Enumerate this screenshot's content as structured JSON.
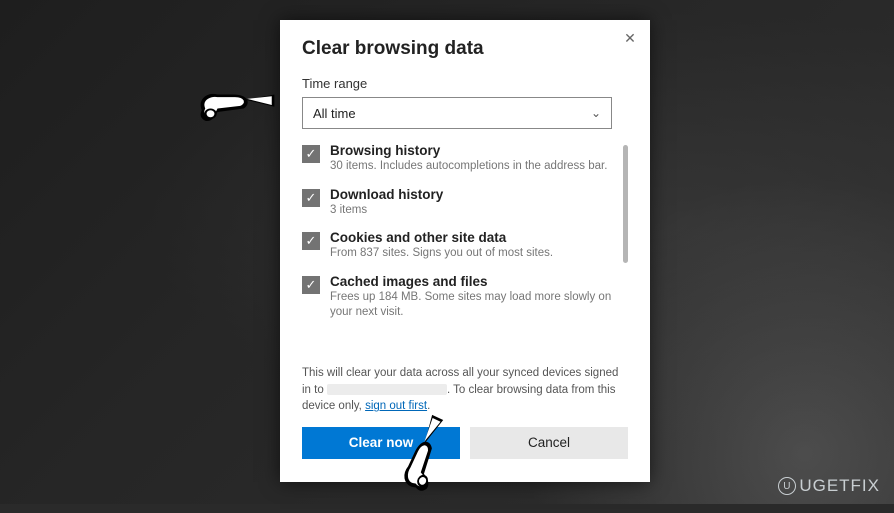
{
  "dialog": {
    "title": "Clear browsing data",
    "time_range_label": "Time range",
    "time_range_value": "All time",
    "options": [
      {
        "title": "Browsing history",
        "desc": "30 items. Includes autocompletions in the address bar."
      },
      {
        "title": "Download history",
        "desc": "3 items"
      },
      {
        "title": "Cookies and other site data",
        "desc": "From 837 sites. Signs you out of most sites."
      },
      {
        "title": "Cached images and files",
        "desc": "Frees up 184 MB. Some sites may load more slowly on your next visit."
      }
    ],
    "sync_note_pre": "This will clear your data across all your synced devices signed in to ",
    "sync_note_mid": ". To clear browsing data from this device only, ",
    "sign_out_link": "sign out first",
    "sync_note_post": ".",
    "primary_button": "Clear now",
    "secondary_button": "Cancel"
  },
  "watermark": {
    "ring": "U",
    "text": "UGETFIX"
  }
}
